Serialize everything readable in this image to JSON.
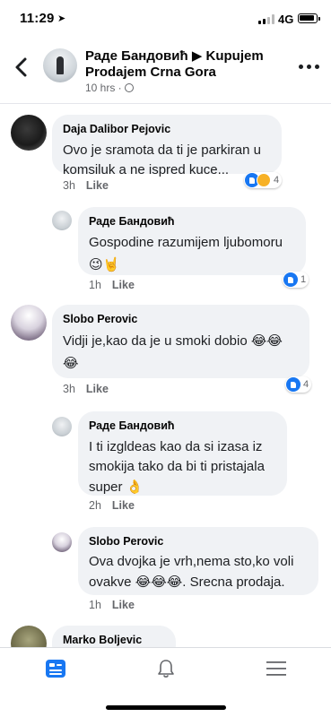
{
  "status": {
    "time": "11:29",
    "network": "4G"
  },
  "header": {
    "title": "Раде Бандовић ▶ Kupujem Prodajem Crna Gora",
    "meta": "10 hrs ·"
  },
  "comments": [
    {
      "author": "Daja Dalibor Pejovic",
      "text": "Ovo je sramota da ti je parkiran u komsiluk a ne ispred kuce...",
      "emoji": "",
      "time": "3h",
      "like": "Like",
      "reactions": [
        "like",
        "haha"
      ],
      "reaction_count": "4"
    },
    {
      "author": "Раде Бандовић",
      "text": "Gospodine razumijem ljubomoru",
      "emoji": "😉🤘",
      "time": "1h",
      "like": "Like",
      "reactions": [
        "like"
      ],
      "reaction_count": "1"
    },
    {
      "author": "Slobo Perovic",
      "text": "Vidji je,kao da je u smoki dobio",
      "emoji": "😂😂",
      "emoji2": "😂",
      "time": "3h",
      "like": "Like",
      "reactions": [
        "like"
      ],
      "reaction_count": "4"
    },
    {
      "author": "Раде Бандовић",
      "text": "I ti izgldeas kao da si izasa iz smokija tako da bi ti pristajala super",
      "emoji": "👌",
      "time": "2h",
      "like": "Like"
    },
    {
      "author": "Slobo Perovic",
      "text": "Ova dvojka je vrh,nema sto,ko voli ovakve",
      "emoji": "😂😂😂",
      "text_after": ". Srecna prodaja.",
      "time": "1h",
      "like": "Like"
    },
    {
      "author": "Marko Boljevic"
    }
  ],
  "nav": {
    "tabs": [
      "feed",
      "notifications",
      "menu"
    ],
    "active": "feed"
  },
  "colors": {
    "accent": "#1877f2",
    "bubble": "#f0f2f5",
    "meta": "#65676b"
  }
}
